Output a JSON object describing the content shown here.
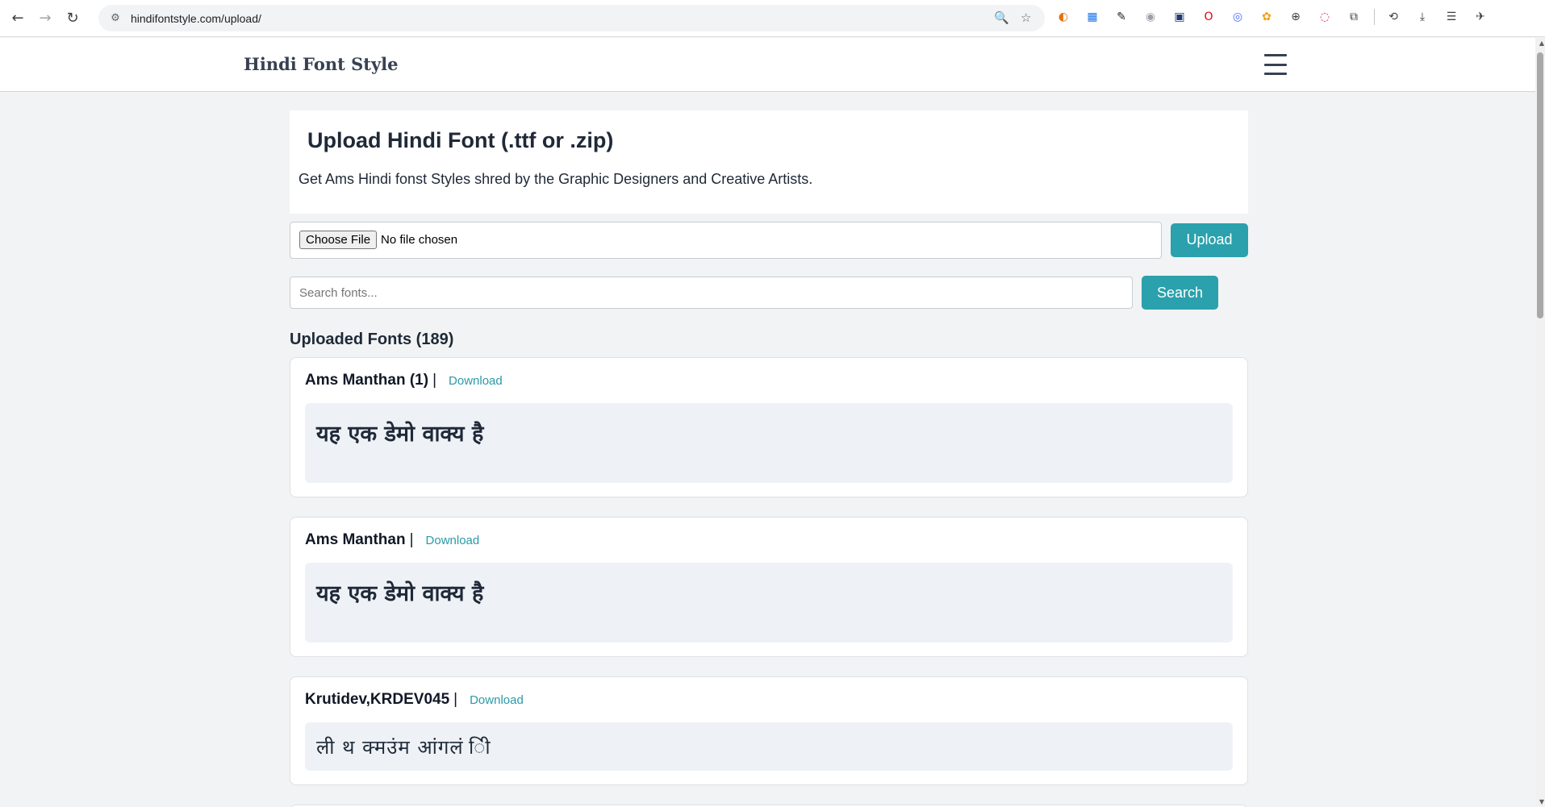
{
  "browser": {
    "url": "hindifontstyle.com/upload/",
    "nav": {
      "back": "←",
      "forward": "→",
      "reload": "↻",
      "site_info": "⚙"
    },
    "omni_icons": {
      "zoom": "🔍",
      "bookmark": "☆"
    },
    "extensions": [
      {
        "name": "ext-1-icon",
        "glyph": "◐",
        "color": "#e8710a"
      },
      {
        "name": "ext-2-icon",
        "glyph": "▦",
        "color": "#1a73e8"
      },
      {
        "name": "eyedropper-icon",
        "glyph": "✎",
        "color": "#202124"
      },
      {
        "name": "ext-4-icon",
        "glyph": "◉",
        "color": "#9aa0a6"
      },
      {
        "name": "save-icon",
        "glyph": "▣",
        "color": "#1f3b73"
      },
      {
        "name": "opera-icon",
        "glyph": "O",
        "color": "#e3000f"
      },
      {
        "name": "ext-7-icon",
        "glyph": "◎",
        "color": "#4c6ef5"
      },
      {
        "name": "ext-8-icon",
        "glyph": "✿",
        "color": "#f59e0b"
      },
      {
        "name": "globe-icon",
        "glyph": "⊕",
        "color": "#3c4043"
      },
      {
        "name": "ext-10-icon",
        "glyph": "◌",
        "color": "#e91e63"
      },
      {
        "name": "puzzle-icon",
        "glyph": "⧉",
        "color": "#3c4043"
      }
    ],
    "right_icons": [
      {
        "name": "history-icon",
        "glyph": "⟲"
      },
      {
        "name": "download-icon",
        "glyph": "⤓"
      },
      {
        "name": "reading-list-icon",
        "glyph": "☰"
      },
      {
        "name": "profile-icon",
        "glyph": "✈"
      }
    ]
  },
  "site": {
    "brand": "Hindi Font Style"
  },
  "page": {
    "title": "Upload Hindi Font (.ttf or .zip)",
    "subtitle": "Get Ams Hindi fonst Styles shred by the Graphic Designers and Creative Artists.",
    "choose_file_label": "Choose File",
    "file_status": "No file chosen",
    "upload_label": "Upload",
    "search_placeholder": "Search fonts...",
    "search_label": "Search",
    "list_heading": "Uploaded Fonts (189)"
  },
  "fonts": [
    {
      "name": "Ams Manthan (1)",
      "separator": "|",
      "download": "Download",
      "preview": "यह एक डेमो वाक्य है"
    },
    {
      "name": "Ams Manthan",
      "separator": "|",
      "download": "Download",
      "preview": "यह एक डेमो वाक्य है"
    },
    {
      "name": "Krutidev,KRDEV045",
      "separator": "|",
      "download": "Download",
      "preview": "ली थ क्मउंम आंगलं ीि"
    }
  ]
}
